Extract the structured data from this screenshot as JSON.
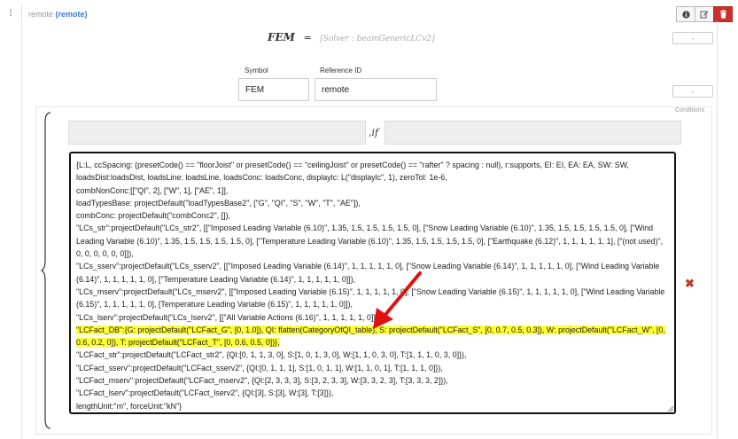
{
  "header": {
    "grip": "⁞",
    "title": "remote",
    "kind": "(remote)",
    "icons": [
      "info-icon",
      "edit-icon",
      "trash-icon"
    ]
  },
  "formula": {
    "name": "FEM",
    "equals": "=",
    "solver": "[Solver : beamGenericLCv2]"
  },
  "buttons": {
    "top_small": "-",
    "mid_small": "-"
  },
  "fields": {
    "symbol_label": "Symbol",
    "symbol_value": "FEM",
    "refid_label": "Reference ID",
    "refid_value": "remote"
  },
  "conditions": {
    "label": "Conditions",
    "if_text": ",if"
  },
  "code": {
    "lines": [
      "{L:L, ccSpacing: (presetCode() == \"floorJoist\" or presetCode() == \"ceilingJoist\" or presetCode() == \"rafter\" ? spacing : null), r:supports, EI: EI, EA: EA, SW: SW, loadsDist:loadsDist, loadsLine: loadsLine, loadsConc: loadsConc, displaylc: L(\"displaylc\", 1), zeroTol: 1e-6,",
      "combNonConc:[[\"QI\", 2], [\"W\", 1], [\"AE\", 1]],",
      "loadTypesBase: projectDefault(\"loadTypesBase2\", [\"G\", \"QI\", \"S\", \"W\", \"T\", \"AE\"]),",
      "combConc: projectDefault(\"combConc2\", []),",
      "\"LCs_str\":projectDefault(\"LCs_str2\", [[\"Imposed Leading Variable (6.10)\", 1.35, 1.5, 1.5, 1.5, 1.5, 0], [\"Snow Leading Variable (6.10)\", 1.35, 1.5, 1.5, 1.5, 1.5, 0], [\"Wind Leading Variable (6.10)\", 1.35, 1.5, 1.5, 1.5, 1.5, 0], [\"Temperature Leading Variable (6.10)\", 1.35, 1.5, 1.5, 1.5, 1.5, 0], [\"Earthquake (6.12)\", 1, 1, 1, 1, 1, 1], [\"(not used)\", 0, 0, 0, 0, 0, 0]]),",
      "\"LCs_sserv\":projectDefault(\"LCs_sserv2\", [[\"Imposed Leading Variable (6.14)\", 1, 1, 1, 1, 1, 0], [\"Snow Leading Variable (6.14)\", 1, 1, 1, 1, 1, 0], [\"Wind Leading Variable (6.14)\", 1, 1, 1, 1, 1, 0], [\"Temperature Leading Variable (6.14)\", 1, 1, 1, 1, 1, 0]]),",
      "\"LCs_mserv\":projectDefault(\"LCs_mserv2\", [[\"Imposed Leading Variable (6.15)\", 1, 1, 1, 1, 1, 0], [\"Snow Leading Variable (6.15)\", 1, 1, 1, 1, 1, 0], [\"Wind Leading Variable (6.15)\", 1, 1, 1, 1, 1, 0], [Temperature Leading Variable (6.15)\", 1, 1, 1, 1, 1, 0]]),",
      "\"LCs_lserv\":projectDefault(\"LCs_lserv2\", [[\"All Variable Actions (6.16)\", 1, 1, 1, 1, 1, 0]]),",
      "\"LCFact_DB\":{G: projectDefault(\"LCFact_G\", [0, 1.0]), QI: flatten(CategoryOfQI_table), S: projectDefault(\"LCFact_S\", [0, 0.7, 0.5, 0.3]), W: projectDefault(\"LCFact_W\", [0, 0.6, 0.2, 0]), T: projectDefault(\"LCFact_T\", [0, 0.6, 0.5, 0])},",
      "\"LCFact_str\":projectDefault(\"LCFact_str2\", {QI:[0, 1, 1, 3, 0], S:[1, 0, 1, 3, 0], W:[1, 1, 0, 3, 0], T:[1, 1, 1, 0, 3, 0]}),",
      "\"LCFact_sserv\":projectDefault(\"LCFact_sserv2\", {QI:[0, 1, 1, 1], S:[1, 0, 1, 1], W:[1, 1, 0, 1], T:[1, 1, 1, 0]}),",
      "\"LCFact_mserv\":projectDefault(\"LCFact_mserv2\", {QI:[2, 3, 3, 3], S:[3, 2, 3, 3], W:[3, 3, 2, 3], T:[3, 3, 3, 2]}),",
      "\"LCFact_lserv\":projectDefault(\"LCFact_lserv2\", {QI:[3], S:[3], W:[3], T:[3]}),",
      "lengthUnit:\"m\", forceUnit:\"kN\"}"
    ],
    "highlighted_index": 8
  },
  "colors": {
    "accent": "#3a7bd5",
    "delete": "#c0392b",
    "highlight": "#ffff33",
    "arrow": "#e01010"
  }
}
